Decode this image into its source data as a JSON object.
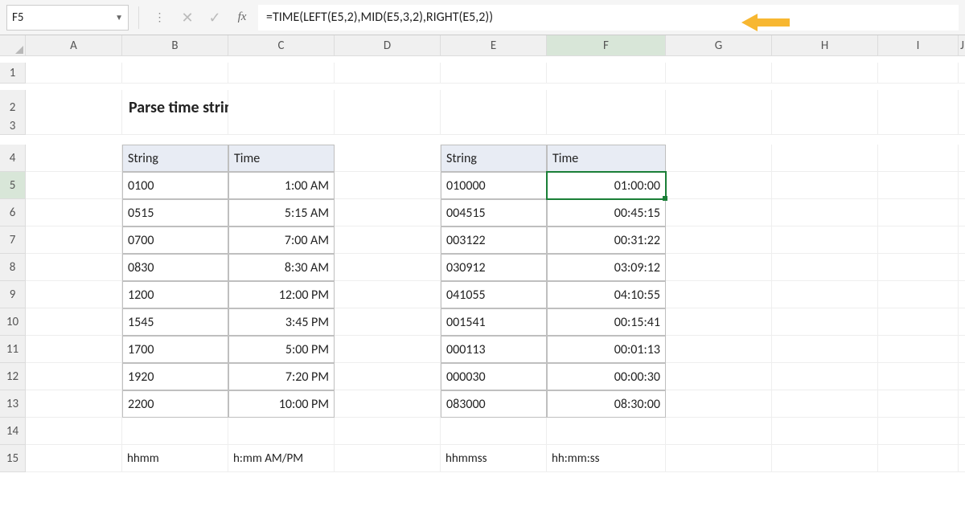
{
  "namebox": "F5",
  "formula": "=TIME(LEFT(E5,2),MID(E5,3,2),RIGHT(E5,2))",
  "columns": [
    "A",
    "B",
    "C",
    "D",
    "E",
    "F",
    "G",
    "H",
    "I",
    "J"
  ],
  "rows": [
    "1",
    "2",
    "3",
    "4",
    "5",
    "6",
    "7",
    "8",
    "9",
    "10",
    "11",
    "12",
    "13",
    "14",
    "15"
  ],
  "active": {
    "col": "F",
    "row": "5"
  },
  "title": "Parse time string to time",
  "table1": {
    "headers": [
      "String",
      "Time"
    ],
    "rows": [
      [
        "0100",
        "1:00 AM"
      ],
      [
        "0515",
        "5:15 AM"
      ],
      [
        "0700",
        "7:00 AM"
      ],
      [
        "0830",
        "8:30 AM"
      ],
      [
        "1200",
        "12:00 PM"
      ],
      [
        "1545",
        "3:45 PM"
      ],
      [
        "1700",
        "5:00 PM"
      ],
      [
        "1920",
        "7:20 PM"
      ],
      [
        "2200",
        "10:00 PM"
      ]
    ],
    "footer": [
      "hhmm",
      "h:mm AM/PM"
    ]
  },
  "table2": {
    "headers": [
      "String",
      "Time"
    ],
    "rows": [
      [
        "010000",
        "01:00:00"
      ],
      [
        "004515",
        "00:45:15"
      ],
      [
        "003122",
        "00:31:22"
      ],
      [
        "030912",
        "03:09:12"
      ],
      [
        "041055",
        "04:10:55"
      ],
      [
        "001541",
        "00:15:41"
      ],
      [
        "000113",
        "00:01:13"
      ],
      [
        "000030",
        "00:00:30"
      ],
      [
        "083000",
        "08:30:00"
      ]
    ],
    "footer": [
      "hhmmss",
      "hh:mm:ss"
    ]
  },
  "arrow_color": "#f7b731"
}
